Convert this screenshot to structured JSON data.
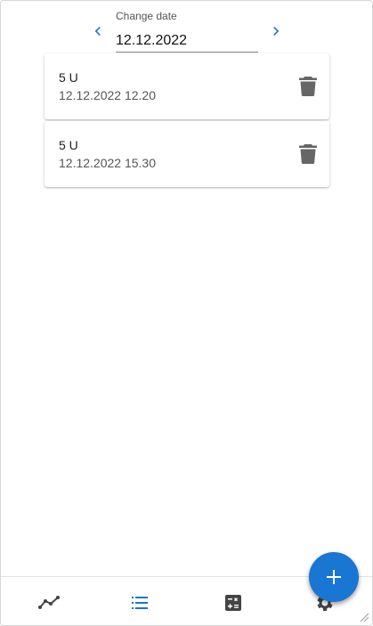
{
  "date_nav": {
    "label": "Change date",
    "value": "12.12.2022"
  },
  "entries": [
    {
      "amount": "5 U",
      "timestamp": "12.12.2022 12.20"
    },
    {
      "amount": "5 U",
      "timestamp": "12.12.2022 15.30"
    }
  ],
  "bottom_nav": {
    "items": [
      {
        "icon": "trend-line-icon",
        "active": false
      },
      {
        "icon": "list-icon",
        "active": true
      },
      {
        "icon": "calculator-icon",
        "active": false
      },
      {
        "icon": "gear-icon",
        "active": false
      }
    ]
  },
  "colors": {
    "accent": "#1976d2",
    "icon_inactive": "#555555",
    "fab": "#1976d2"
  }
}
